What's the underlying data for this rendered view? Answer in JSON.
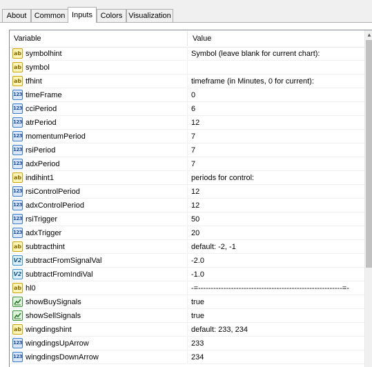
{
  "tabs": [
    {
      "label": "About",
      "active": false
    },
    {
      "label": "Common",
      "active": false
    },
    {
      "label": "Inputs",
      "active": true
    },
    {
      "label": "Colors",
      "active": false
    },
    {
      "label": "Visualization",
      "active": false
    }
  ],
  "grid": {
    "columns": {
      "variable": "Variable",
      "value": "Value"
    },
    "rows": [
      {
        "type": "ab",
        "name": "symbolhint",
        "value": "Symbol (leave blank for current chart):"
      },
      {
        "type": "ab",
        "name": "symbol",
        "value": ""
      },
      {
        "type": "ab",
        "name": "tfhint",
        "value": "timeframe (in Minutes, 0 for current):"
      },
      {
        "type": "123",
        "name": "timeFrame",
        "value": "0"
      },
      {
        "type": "123",
        "name": "cciPeriod",
        "value": "6"
      },
      {
        "type": "123",
        "name": "atrPeriod",
        "value": "12"
      },
      {
        "type": "123",
        "name": "momentumPeriod",
        "value": "7"
      },
      {
        "type": "123",
        "name": "rsiPeriod",
        "value": "7"
      },
      {
        "type": "123",
        "name": "adxPeriod",
        "value": "7"
      },
      {
        "type": "ab",
        "name": "indihint1",
        "value": "periods for control:"
      },
      {
        "type": "123",
        "name": "rsiControlPeriod",
        "value": "12"
      },
      {
        "type": "123",
        "name": "adxControlPeriod",
        "value": "12"
      },
      {
        "type": "123",
        "name": "rsiTrigger",
        "value": "50"
      },
      {
        "type": "123",
        "name": "adxTrigger",
        "value": "20"
      },
      {
        "type": "ab",
        "name": "subtracthint",
        "value": "default: -2, -1"
      },
      {
        "type": "v12",
        "name": "subtractFromSignalVal",
        "value": "-2.0"
      },
      {
        "type": "v12",
        "name": "subtractFromIndiVal",
        "value": "-1.0"
      },
      {
        "type": "ab",
        "name": "hl0",
        "value": "-=---------------------------------------------------------=-"
      },
      {
        "type": "bool",
        "name": "showBuySignals",
        "value": "true"
      },
      {
        "type": "bool",
        "name": "showSellSignals",
        "value": "true"
      },
      {
        "type": "ab",
        "name": "wingdingshint",
        "value": "default: 233, 234"
      },
      {
        "type": "123",
        "name": "wingdingsUpArrow",
        "value": "233"
      },
      {
        "type": "123",
        "name": "wingdingsDownArrow",
        "value": "234"
      }
    ]
  },
  "icons": {
    "ab": "ab",
    "123": "123",
    "v12": "V2"
  }
}
